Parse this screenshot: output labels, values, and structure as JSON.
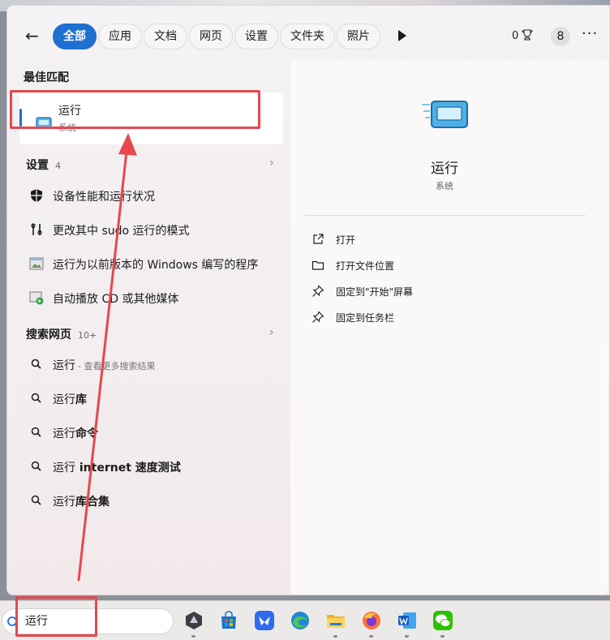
{
  "filters": {
    "back_icon": "back-arrow-icon",
    "chips": [
      "全部",
      "应用",
      "文档",
      "网页",
      "设置",
      "文件夹",
      "照片"
    ],
    "points": "0",
    "badge": "8",
    "more": "···"
  },
  "best_match": {
    "heading": "最佳匹配",
    "title": "运行",
    "subtitle": "系统"
  },
  "settings": {
    "heading": "设置",
    "count": "4",
    "items": [
      {
        "label": "设备性能和运行状况",
        "icon": "shield-icon"
      },
      {
        "label": "更改其中 sudo 运行的模式",
        "icon": "sudo-icon"
      },
      {
        "label": "运行为以前版本的 Windows 编写的程序",
        "icon": "compat-window-icon"
      },
      {
        "label": "自动播放 CD 或其他媒体",
        "icon": "autoplay-icon"
      }
    ]
  },
  "web": {
    "heading": "搜索网页",
    "count": "10+",
    "items": [
      {
        "label": "运行",
        "hint": "- 查看更多搜索结果",
        "bold": ""
      },
      {
        "label": "运行",
        "bold": "库"
      },
      {
        "label": "运行",
        "bold": "命令"
      },
      {
        "label": "运行",
        "bold": " internet 速度测试"
      },
      {
        "label": "运行",
        "bold": "库合集"
      }
    ]
  },
  "detail": {
    "name": "运行",
    "type": "系统",
    "actions": [
      {
        "label": "打开",
        "icon": "open-external-icon"
      },
      {
        "label": "打开文件位置",
        "icon": "folder-icon"
      },
      {
        "label": "固定到\"开始\"屏幕",
        "icon": "pin-icon"
      },
      {
        "label": "固定到任务栏",
        "icon": "pin-icon"
      }
    ]
  },
  "taskbar": {
    "search_value": "运行",
    "apps": [
      "app-hexagon-icon",
      "microsoft-store-icon",
      "feishu-icon",
      "edge-icon",
      "file-explorer-icon",
      "firefox-icon",
      "word-icon",
      "wechat-icon"
    ]
  },
  "colors": {
    "accent": "#1f6fd0",
    "annotation": "#e5484d"
  }
}
